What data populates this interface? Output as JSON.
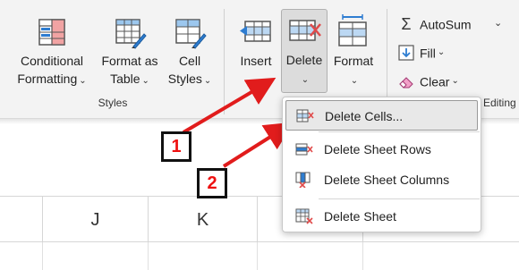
{
  "ribbon": {
    "buttons": {
      "conditional_formatting": {
        "line1": "Conditional",
        "line2": "Formatting",
        "chevron": "⌄"
      },
      "format_as_table": {
        "line1": "Format as",
        "line2": "Table",
        "chevron": "⌄"
      },
      "cell_styles": {
        "line1": "Cell",
        "line2": "Styles",
        "chevron": "⌄"
      },
      "insert": {
        "line1": "Insert",
        "chevron": "⌄"
      },
      "delete": {
        "line1": "Delete",
        "chevron": "⌄"
      },
      "format": {
        "line1": "Format",
        "chevron": "⌄"
      }
    },
    "groups": {
      "styles_label": "Styles",
      "editing_label": "Editing"
    },
    "editing": {
      "autosum": "AutoSum",
      "autosum_chevron": "⌄",
      "fill": "Fill",
      "fill_chevron": "⌄",
      "clear": "Clear",
      "clear_chevron": "⌄"
    }
  },
  "sheet": {
    "columns": [
      "",
      "J",
      "K",
      "",
      ""
    ]
  },
  "delete_menu": {
    "items": [
      {
        "label": "Delete Cells...",
        "icon": "delete-cells-icon"
      },
      {
        "label": "Delete Sheet Rows",
        "icon": "delete-rows-icon"
      },
      {
        "label": "Delete Sheet Columns",
        "icon": "delete-columns-icon"
      },
      {
        "label": "Delete Sheet",
        "icon": "delete-sheet-icon"
      }
    ]
  },
  "callouts": {
    "one": "1",
    "two": "2"
  },
  "colors": {
    "accent_red": "#e11c1c",
    "icon_blue": "#2e7dd1",
    "icon_red": "#e04a4a",
    "ribbon_bg": "#f3f3f3"
  }
}
